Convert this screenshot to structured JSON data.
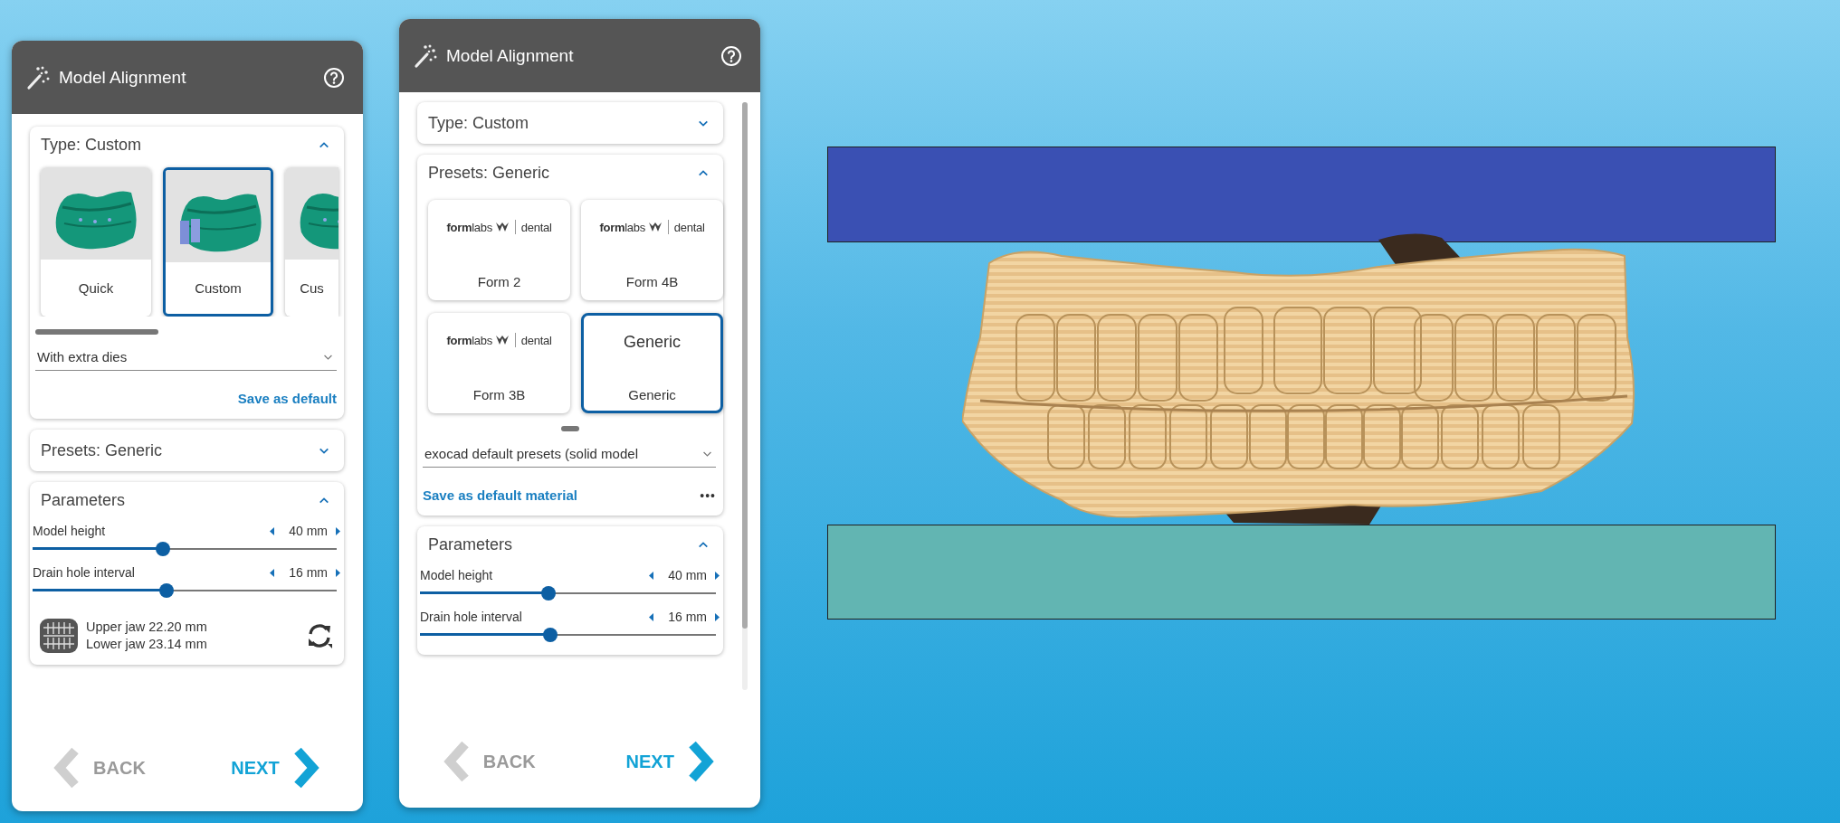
{
  "panels": [
    {
      "title": "Model Alignment",
      "scrollbar": false,
      "sections": [
        {
          "kind": "type",
          "title": "Type: Custom",
          "expanded": true,
          "cards": [
            {
              "label": "Quick",
              "selected": false
            },
            {
              "label": "Custom",
              "selected": true
            },
            {
              "label": "Cus",
              "selected": false
            }
          ],
          "dropdown": "With extra dies",
          "link": "Save as default"
        },
        {
          "title": "Presets: Generic",
          "expanded": false
        },
        {
          "kind": "parameters",
          "title": "Parameters",
          "expanded": true,
          "sliders": [
            {
              "label": "Model height",
              "value": "40 mm",
              "level": 0.43
            },
            {
              "label": "Drain hole interval",
              "value": "16 mm",
              "level": 0.44
            }
          ],
          "jaw_info": [
            "Upper jaw 22.20 mm",
            "Lower jaw 23.14 mm"
          ]
        }
      ],
      "back": {
        "label": "BACK",
        "disabled": true
      },
      "next": {
        "label": "NEXT",
        "disabled": false
      }
    },
    {
      "title": "Model Alignment",
      "scrollbar": true,
      "sections": [
        {
          "title": "Type: Custom",
          "expanded": false
        },
        {
          "kind": "presets",
          "title": "Presets: Generic",
          "expanded": true,
          "cards": [
            {
              "kind": "logo",
              "logo": "**form**labs",
              "logo_suffix": "dental",
              "label": "Form 2",
              "selected": false
            },
            {
              "kind": "logo",
              "logo": "**form**labs",
              "logo_suffix": "dental",
              "label": "Form 4B",
              "selected": false
            },
            {
              "kind": "logo",
              "logo": "**form**labs",
              "logo_suffix": "dental",
              "label": "Form 3B",
              "selected": false
            },
            {
              "kind": "text",
              "heading": "Generic",
              "label": "Generic",
              "selected": true
            }
          ],
          "dropdown": "exocad default presets (solid model",
          "link": "Save as default material",
          "more": "•••"
        },
        {
          "kind": "parameters",
          "title": "Parameters",
          "expanded": true,
          "sliders": [
            {
              "label": "Model height",
              "value": "40 mm",
              "level": 0.435
            },
            {
              "label": "Drain hole interval",
              "value": "16 mm",
              "level": 0.44
            }
          ]
        }
      ],
      "back": {
        "label": "BACK",
        "disabled": true
      },
      "next": {
        "label": "NEXT",
        "disabled": false
      }
    }
  ]
}
